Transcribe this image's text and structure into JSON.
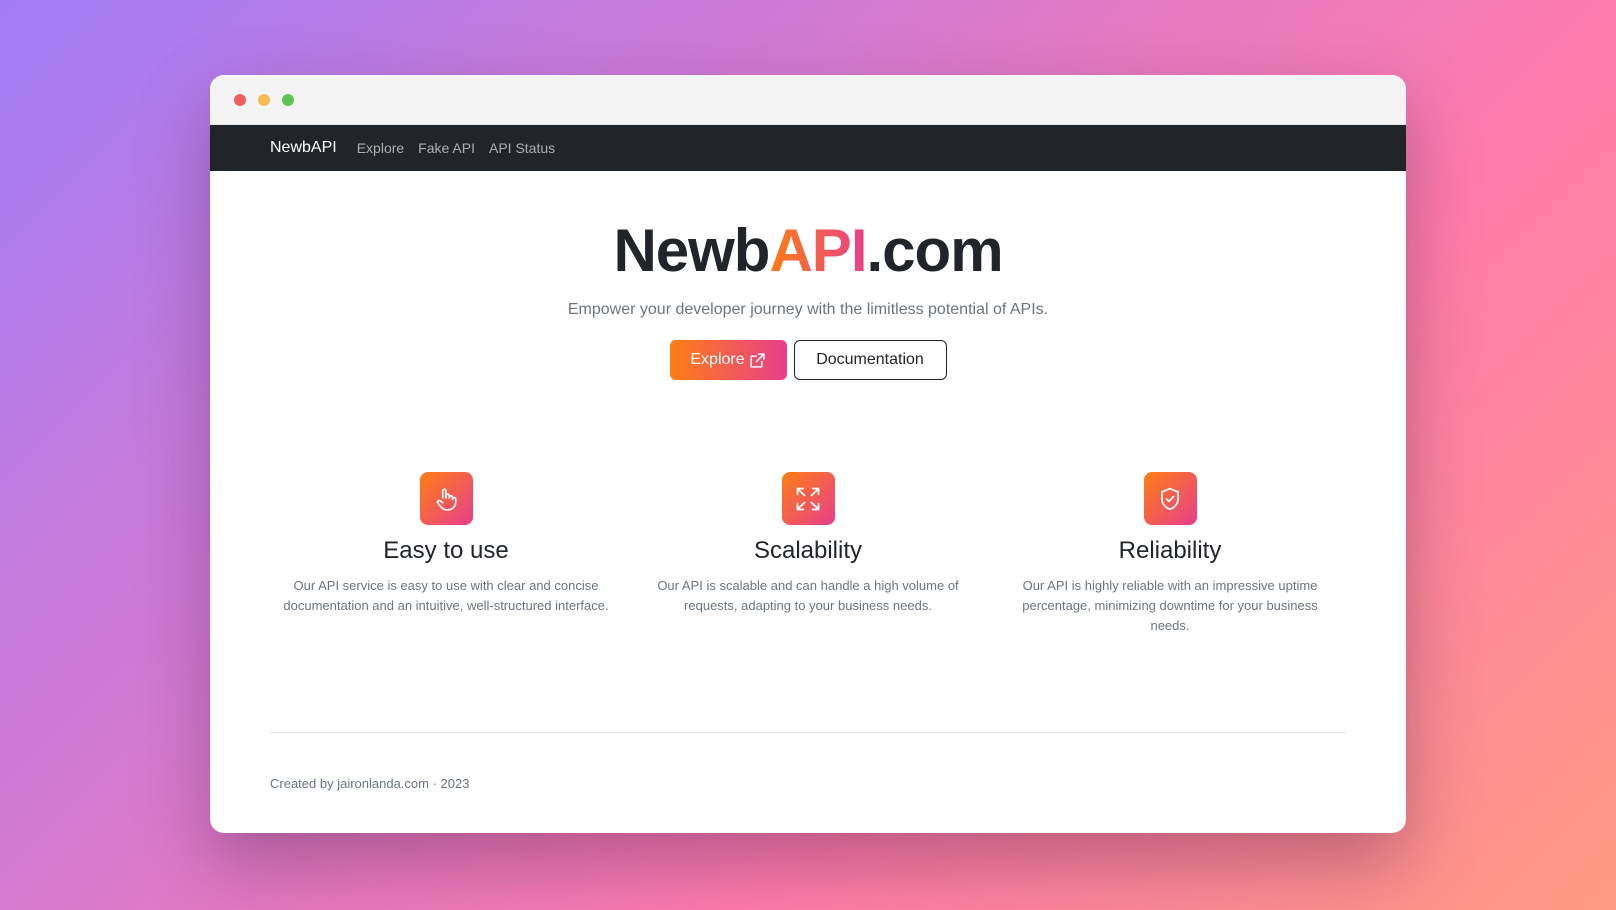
{
  "window": {
    "controls": [
      "close",
      "minimize",
      "maximize"
    ]
  },
  "navbar": {
    "brand": "NewbAPI",
    "links": [
      {
        "label": "Explore"
      },
      {
        "label": "Fake API"
      },
      {
        "label": "API Status"
      }
    ]
  },
  "hero": {
    "title_prefix": "Newb",
    "title_accent": "API",
    "title_suffix": ".com",
    "tagline": "Empower your developer journey with the limitless potential of APIs.",
    "explore_label": "Explore",
    "docs_label": "Documentation"
  },
  "features": [
    {
      "icon": "hand-pointer-icon",
      "title": "Easy to use",
      "description": "Our API service is easy to use with clear and concise documentation and an intuitive, well-structured interface."
    },
    {
      "icon": "arrows-expand-icon",
      "title": "Scalability",
      "description": "Our API is scalable and can handle a high volume of requests, adapting to your business needs."
    },
    {
      "icon": "shield-check-icon",
      "title": "Reliability",
      "description": "Our API is highly reliable with an impressive uptime percentage, minimizing downtime for your business needs."
    }
  ],
  "footer": {
    "text": "Created by jaironlanda.com · 2023"
  },
  "colors": {
    "accent_start": "#fd7e14",
    "accent_end": "#e83e8c",
    "navbar_bg": "#212529"
  }
}
